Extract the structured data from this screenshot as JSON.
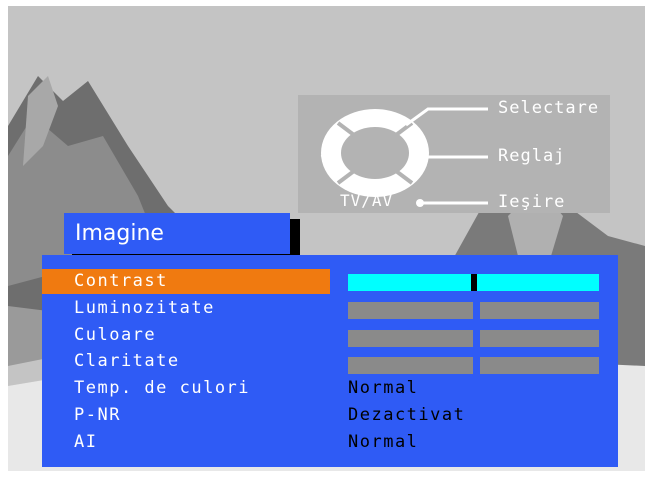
{
  "help": {
    "select_label": "Selectare",
    "adjust_label": "Reglaj",
    "exit_label": "Ieşire",
    "tvav_label": "TV/AV",
    "up_symbol": "^",
    "down_symbol": "v",
    "minus_symbol": "−",
    "plus_symbol": "+"
  },
  "menu": {
    "title": "Imagine",
    "items": [
      {
        "label": "Contrast",
        "selected": true
      },
      {
        "label": "Luminozitate"
      },
      {
        "label": "Culoare"
      },
      {
        "label": "Claritate"
      },
      {
        "label": "Temp. de culori",
        "value": "Normal"
      },
      {
        "label": "P-NR",
        "value": "Dezactivat"
      },
      {
        "label": "AI",
        "value": "Normal"
      }
    ],
    "contrast_level": 0.5
  },
  "colors": {
    "panel_blue": "#2f5bf5",
    "selected_orange": "#f07a10",
    "slider_active": "#00ffff",
    "slider_inactive": "#8a8a8a"
  }
}
